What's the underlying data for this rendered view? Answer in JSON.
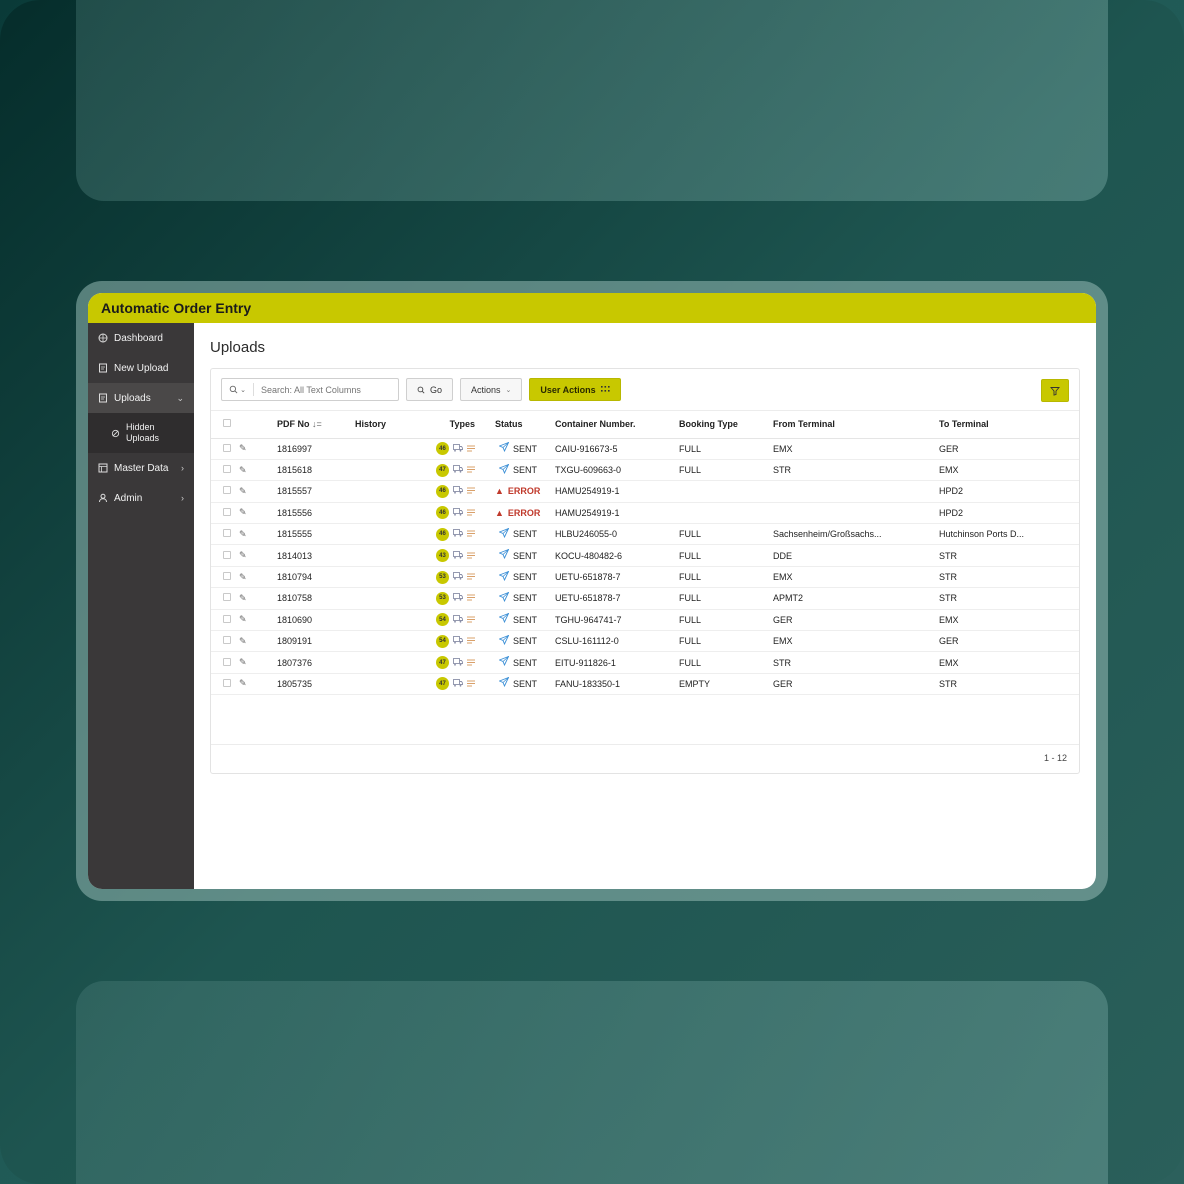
{
  "app": {
    "title": "Automatic Order Entry"
  },
  "sidebar": {
    "items": [
      {
        "label": "Dashboard",
        "icon": "globe-icon"
      },
      {
        "label": "New Upload",
        "icon": "document-icon"
      },
      {
        "label": "Uploads",
        "icon": "document-icon",
        "expanded": true
      },
      {
        "label": "Hidden Uploads",
        "icon": "hidden-icon",
        "sub": true
      },
      {
        "label": "Master Data",
        "icon": "table-icon"
      },
      {
        "label": "Admin",
        "icon": "user-icon"
      }
    ]
  },
  "page": {
    "title": "Uploads"
  },
  "toolbar": {
    "search_placeholder": "Search: All Text Columns",
    "go_label": "Go",
    "actions_label": "Actions",
    "user_actions_label": "User Actions"
  },
  "table": {
    "columns": [
      "PDF No",
      "History",
      "Types",
      "Status",
      "Container Number.",
      "Booking Type",
      "From Terminal",
      "To Terminal"
    ],
    "sort_indicator": "↓=",
    "rows": [
      {
        "pdf": "1816997",
        "badge": "46",
        "status": "SENT",
        "container": "CAIU-916673-5",
        "booking": "FULL",
        "from": "EMX",
        "to": "GER"
      },
      {
        "pdf": "1815618",
        "badge": "47",
        "status": "SENT",
        "container": "TXGU-609663-0",
        "booking": "FULL",
        "from": "STR",
        "to": "EMX"
      },
      {
        "pdf": "1815557",
        "badge": "46",
        "status": "ERROR",
        "container": "HAMU254919-1",
        "booking": "",
        "from": "",
        "to": "HPD2"
      },
      {
        "pdf": "1815556",
        "badge": "46",
        "status": "ERROR",
        "container": "HAMU254919-1",
        "booking": "",
        "from": "",
        "to": "HPD2"
      },
      {
        "pdf": "1815555",
        "badge": "46",
        "status": "SENT",
        "container": "HLBU246055-0",
        "booking": "FULL",
        "from": "Sachsenheim/Großsachs...",
        "to": "Hutchinson Ports D..."
      },
      {
        "pdf": "1814013",
        "badge": "43",
        "status": "SENT",
        "container": "KOCU-480482-6",
        "booking": "FULL",
        "from": "DDE",
        "to": "STR"
      },
      {
        "pdf": "1810794",
        "badge": "53",
        "status": "SENT",
        "container": "UETU-651878-7",
        "booking": "FULL",
        "from": "EMX",
        "to": "STR"
      },
      {
        "pdf": "1810758",
        "badge": "53",
        "status": "SENT",
        "container": "UETU-651878-7",
        "booking": "FULL",
        "from": "APMT2",
        "to": "STR"
      },
      {
        "pdf": "1810690",
        "badge": "54",
        "status": "SENT",
        "container": "TGHU-964741-7",
        "booking": "FULL",
        "from": "GER",
        "to": "EMX"
      },
      {
        "pdf": "1809191",
        "badge": "54",
        "status": "SENT",
        "container": "CSLU-161112-0",
        "booking": "FULL",
        "from": "EMX",
        "to": "GER"
      },
      {
        "pdf": "1807376",
        "badge": "47",
        "status": "SENT",
        "container": "EITU-911826-1",
        "booking": "FULL",
        "from": "STR",
        "to": "EMX"
      },
      {
        "pdf": "1805735",
        "badge": "47",
        "status": "SENT",
        "container": "FANU-183350-1",
        "booking": "EMPTY",
        "from": "GER",
        "to": "STR"
      }
    ]
  },
  "pagination": {
    "label": "1 - 12"
  },
  "colors": {
    "accent": "#c8c800",
    "sidebar": "#3a3839",
    "error": "#c0392b",
    "sent_icon": "#3b8fd6"
  }
}
